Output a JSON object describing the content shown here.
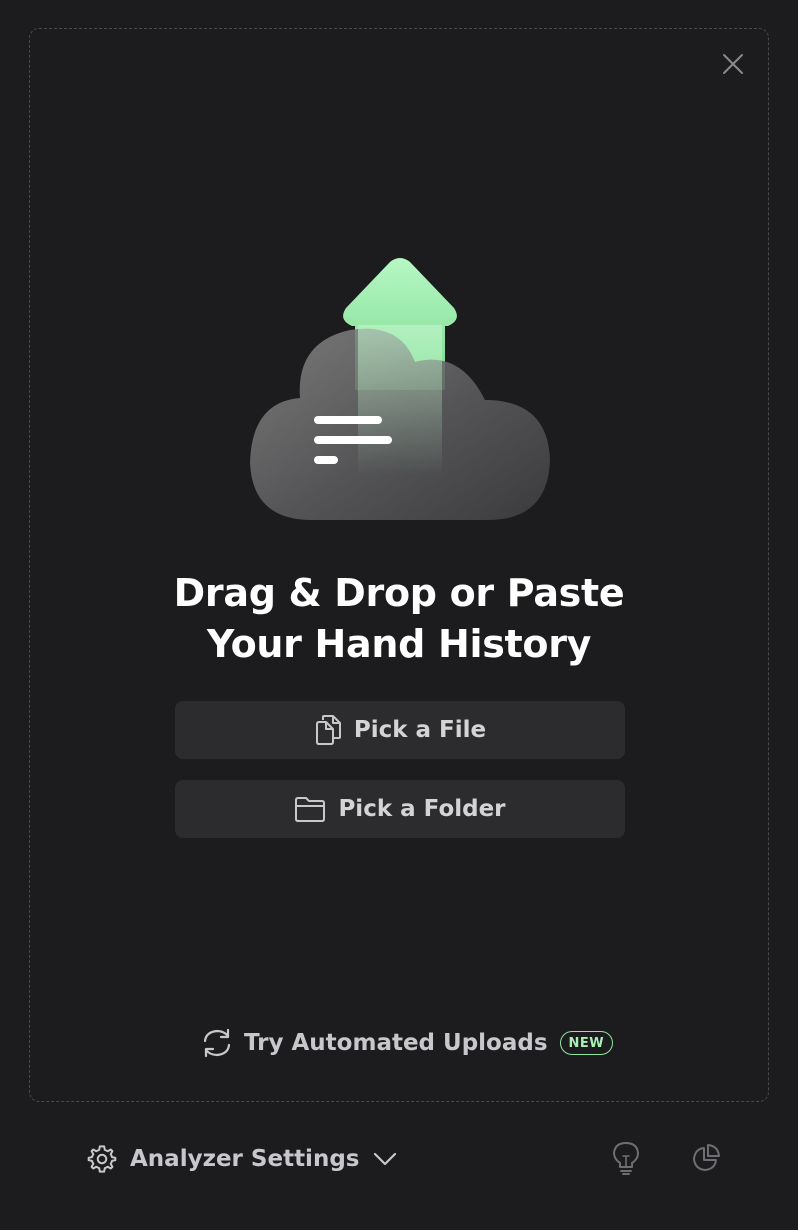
{
  "dropzone": {
    "headline_line1": "Drag & Drop or Paste",
    "headline_line2": "Your Hand History",
    "pick_file_label": "Pick a File",
    "pick_folder_label": "Pick a Folder",
    "automated_uploads_label": "Try Automated Uploads",
    "new_badge": "NEW"
  },
  "footer": {
    "settings_label": "Analyzer Settings"
  },
  "icons": {
    "close": "close-icon",
    "upload": "cloud-upload-icon",
    "file": "files-icon",
    "folder": "folder-icon",
    "sync": "sync-icon",
    "settings": "gear-icon",
    "chevron": "chevron-down-icon",
    "tips": "lightbulb-icon",
    "stats": "pie-chart-icon"
  },
  "colors": {
    "background": "#1c1c1e",
    "button": "#2c2c2e",
    "accent_green": "#8ee6a0"
  }
}
